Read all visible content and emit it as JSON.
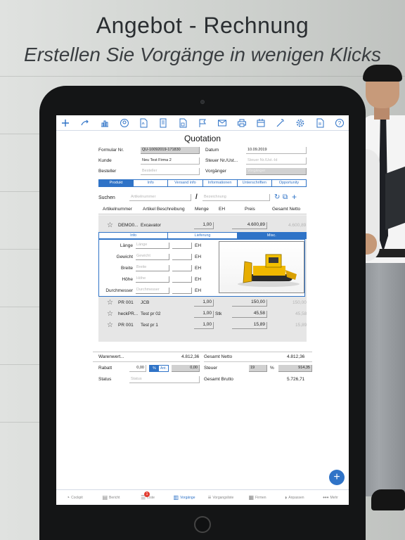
{
  "hero": {
    "title": "Angebot - Rechnung",
    "subtitle": "Erstellen Sie Vorgänge in wenigen Klicks"
  },
  "toolbar": {
    "icons": [
      "plus-icon",
      "convert-icon",
      "chart-icon",
      "person-icon",
      "pdf-icon",
      "document-icon",
      "save-icon",
      "flag-icon",
      "mail-icon",
      "print-icon",
      "calendar-icon",
      "magic-wand-icon",
      "gear-icon",
      "file-icon",
      "help-icon"
    ]
  },
  "doc": {
    "title": "Quotation",
    "formular_label": "Formular Nr.",
    "formular_value": "QU-10092019-171830",
    "datum_label": "Datum",
    "datum_value": "10.09.2019",
    "kunde_label": "Kunde",
    "kunde_value": "Neu Test Firma 2",
    "steuer_label": "Steuer Nr./Ust...",
    "steuer_placeholder": "Steuer Nr./Ust.-Id",
    "besteller_label": "Besteller",
    "besteller_placeholder": "Besteller",
    "vorgaenger_label": "Vorgänger",
    "vorgaenger_placeholder": "Vorgänger"
  },
  "tabs": [
    {
      "label": "Produkt",
      "active": true
    },
    {
      "label": "Info",
      "active": false
    },
    {
      "label": "Versand info",
      "active": false
    },
    {
      "label": "Informationen",
      "active": false
    },
    {
      "label": "Unterschriften",
      "active": false
    },
    {
      "label": "Opportunity",
      "active": false
    }
  ],
  "search": {
    "label": "Suchen",
    "artikelnummer_placeholder": "Artikelnummer",
    "separator": "/",
    "bezeichnung_placeholder": "Bezeichnung"
  },
  "columns": {
    "artikelnummer": "Artikelnummer",
    "beschreibung": "Artikel Beschreibung",
    "menge": "Menge",
    "eh": "EH",
    "preis": "Preis",
    "netto": "Gesamt Netto"
  },
  "first_item": {
    "nr": "DEMO0...",
    "desc": "Excavator",
    "qty": "1,00",
    "price": "4.600,89",
    "net": "4.600,89"
  },
  "subtabs": [
    {
      "label": "Info",
      "active": false
    },
    {
      "label": "Lieferung",
      "active": false
    },
    {
      "label": "Misc.",
      "active": true
    }
  ],
  "dims": [
    {
      "label": "Länge",
      "placeholder": "Länge",
      "eh": "EH"
    },
    {
      "label": "Gewicht",
      "placeholder": "Gewicht",
      "eh": "EH"
    },
    {
      "label": "Breite",
      "placeholder": "Breite",
      "eh": "EH"
    },
    {
      "label": "Höhe",
      "placeholder": "Höhe",
      "eh": "EH"
    },
    {
      "label": "Durchmesser",
      "placeholder": "Durchmesser",
      "eh": "EH"
    }
  ],
  "items": [
    {
      "nr": "PR 001",
      "desc": "JCB",
      "qty": "1,00",
      "eh": "",
      "price": "150,00",
      "net": "150,00"
    },
    {
      "nr": "heckPR...",
      "desc": "Test pr 02",
      "qty": "1,00",
      "eh": "Stk",
      "price": "45,58",
      "net": "45,58"
    },
    {
      "nr": "PR 001",
      "desc": "Test pr 1",
      "qty": "1,00",
      "eh": "",
      "price": "15,89",
      "net": "15,89"
    }
  ],
  "totals": {
    "warenwert_label": "Warenwert...",
    "warenwert_value": "4.812,36",
    "netto_label": "Gesamt Netto",
    "netto_value": "4.812,36",
    "rabatt_label": "Rabatt",
    "rabatt_value": "0,00",
    "pct_label": "%",
    "ant_label": "Ant.",
    "rabatt_amount": "0,00",
    "steuer_label": "Steuer",
    "steuer_rate": "19",
    "steuer_pct": "%",
    "steuer_amount": "914,35",
    "status_label": "Status",
    "status_placeholder": "Status",
    "brutto_label": "Gesamt Brutto",
    "brutto_value": "5.726,71"
  },
  "nav": [
    {
      "label": "Cockpit",
      "icon": "gauge-icon",
      "active": false
    },
    {
      "label": "Bericht",
      "icon": "report-icon",
      "active": false
    },
    {
      "label": "Liste",
      "icon": "list-icon",
      "active": false,
      "badge": "1"
    },
    {
      "label": "Vorgänge",
      "icon": "document-icon",
      "active": true
    },
    {
      "label": "Vorgangsliste",
      "icon": "list-lines-icon",
      "active": false
    },
    {
      "label": "Firmen",
      "icon": "building-icon",
      "active": false
    },
    {
      "label": "Anpassen",
      "icon": "palette-icon",
      "active": false
    },
    {
      "label": "Mehr",
      "icon": "more-icon",
      "active": false
    }
  ],
  "accent": "#2f73c7"
}
